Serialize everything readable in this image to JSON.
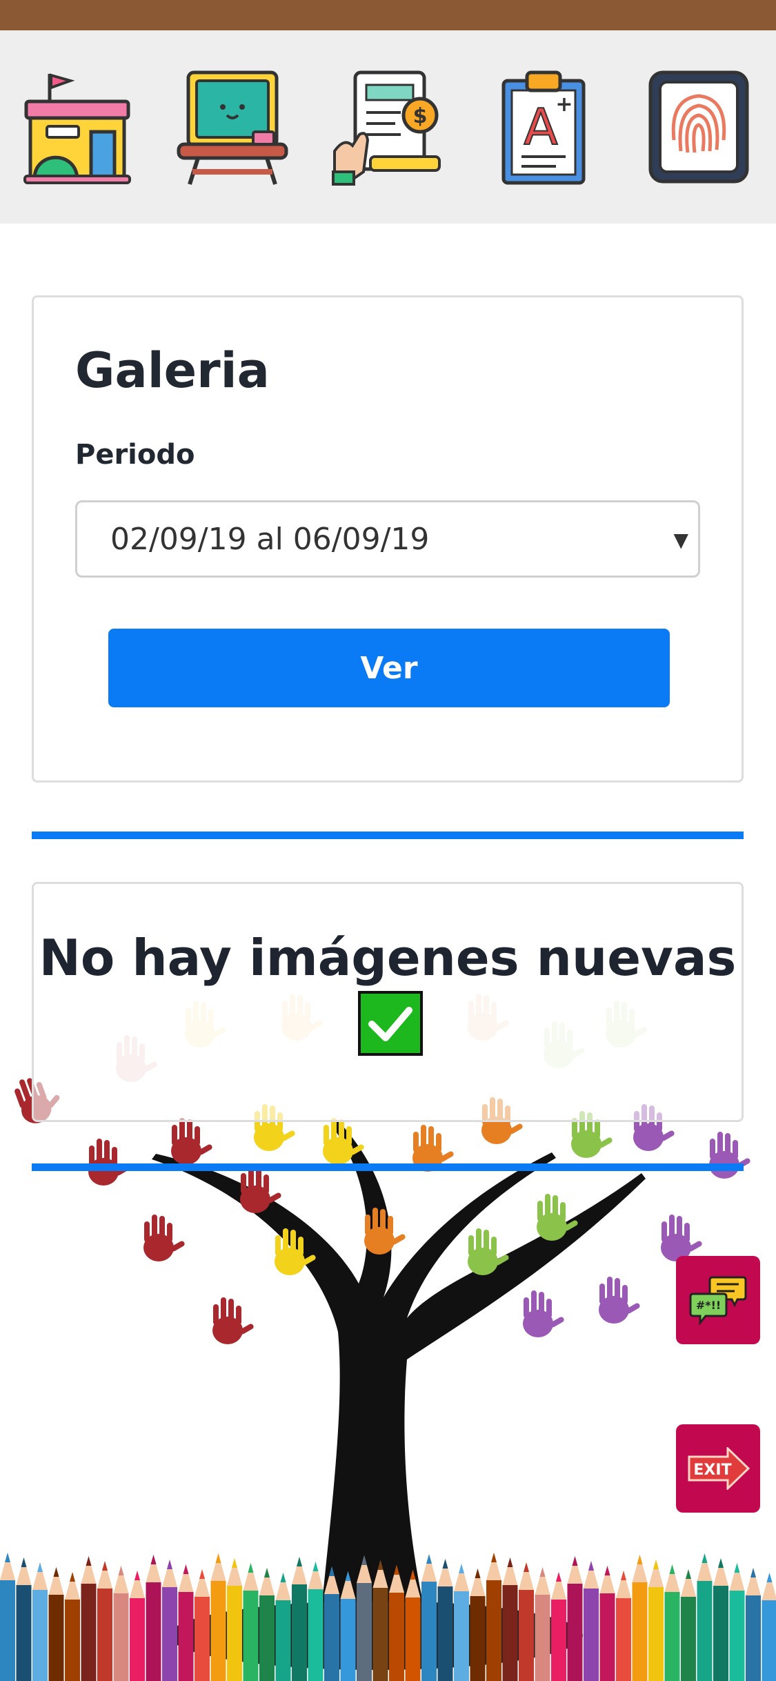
{
  "toolbar": {
    "items": [
      {
        "icon": "school-icon"
      },
      {
        "icon": "classroom-desk-icon"
      },
      {
        "icon": "payment-invoice-icon"
      },
      {
        "icon": "grades-clipboard-icon"
      },
      {
        "icon": "fingerprint-icon"
      }
    ]
  },
  "gallery": {
    "title": "Galeria",
    "period_label": "Periodo",
    "period_value": "02/09/19 al 06/09/19",
    "submit_label": "Ver"
  },
  "empty_state": {
    "message": "No hay imágenes nuevas"
  },
  "fabs": {
    "chat_icon": "chat-bubbles-icon",
    "exit_icon": "exit-sign-icon"
  },
  "colors": {
    "accent": "#0A7AF5",
    "status_strip": "#8B5A34",
    "fab": "#C2094F",
    "check": "#1DB81D"
  }
}
